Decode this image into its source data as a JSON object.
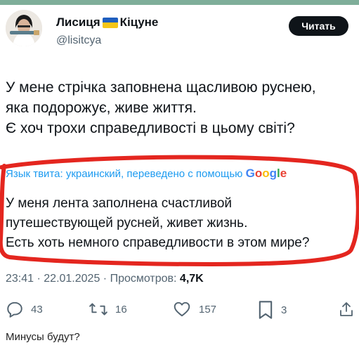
{
  "author": {
    "name_part1": "Лисиця",
    "name_part2": "Кіцуне",
    "handle": "@lisitcya",
    "flag_colors": [
      "#1f5fbf",
      "#f5c518"
    ]
  },
  "header": {
    "follow_label": "Читать"
  },
  "tweet": {
    "lines": [
      "У мене стрічка заповнена щасливою руснею,",
      "яка подорожує, живе життя.",
      "Є хоч трохи справедливості в цьому світі?"
    ]
  },
  "translation": {
    "header": "Язык твита: украинский, переведено с помощью",
    "provider": "Google",
    "lines": [
      "У меня лента заполнена счастливой",
      "путешествующей русней, живет жизнь.",
      "Есть хоть немного справедливости в этом мире?"
    ],
    "annotation_color": "#e4261f"
  },
  "meta": {
    "time": "23:41",
    "separator1": " · ",
    "date": "22.01.2025",
    "separator2": " · ",
    "views_label": "Просмотров: ",
    "views": "4,7K"
  },
  "actions": {
    "replies": {
      "icon": "reply-icon",
      "count": "43"
    },
    "retweets": {
      "icon": "retweet-icon",
      "count": "16"
    },
    "likes": {
      "icon": "heart-icon",
      "count": "157"
    },
    "bookmarks": {
      "icon": "bookmark-icon",
      "count": "3"
    },
    "share": {
      "icon": "share-icon"
    }
  },
  "caption": "Минусы будут?"
}
